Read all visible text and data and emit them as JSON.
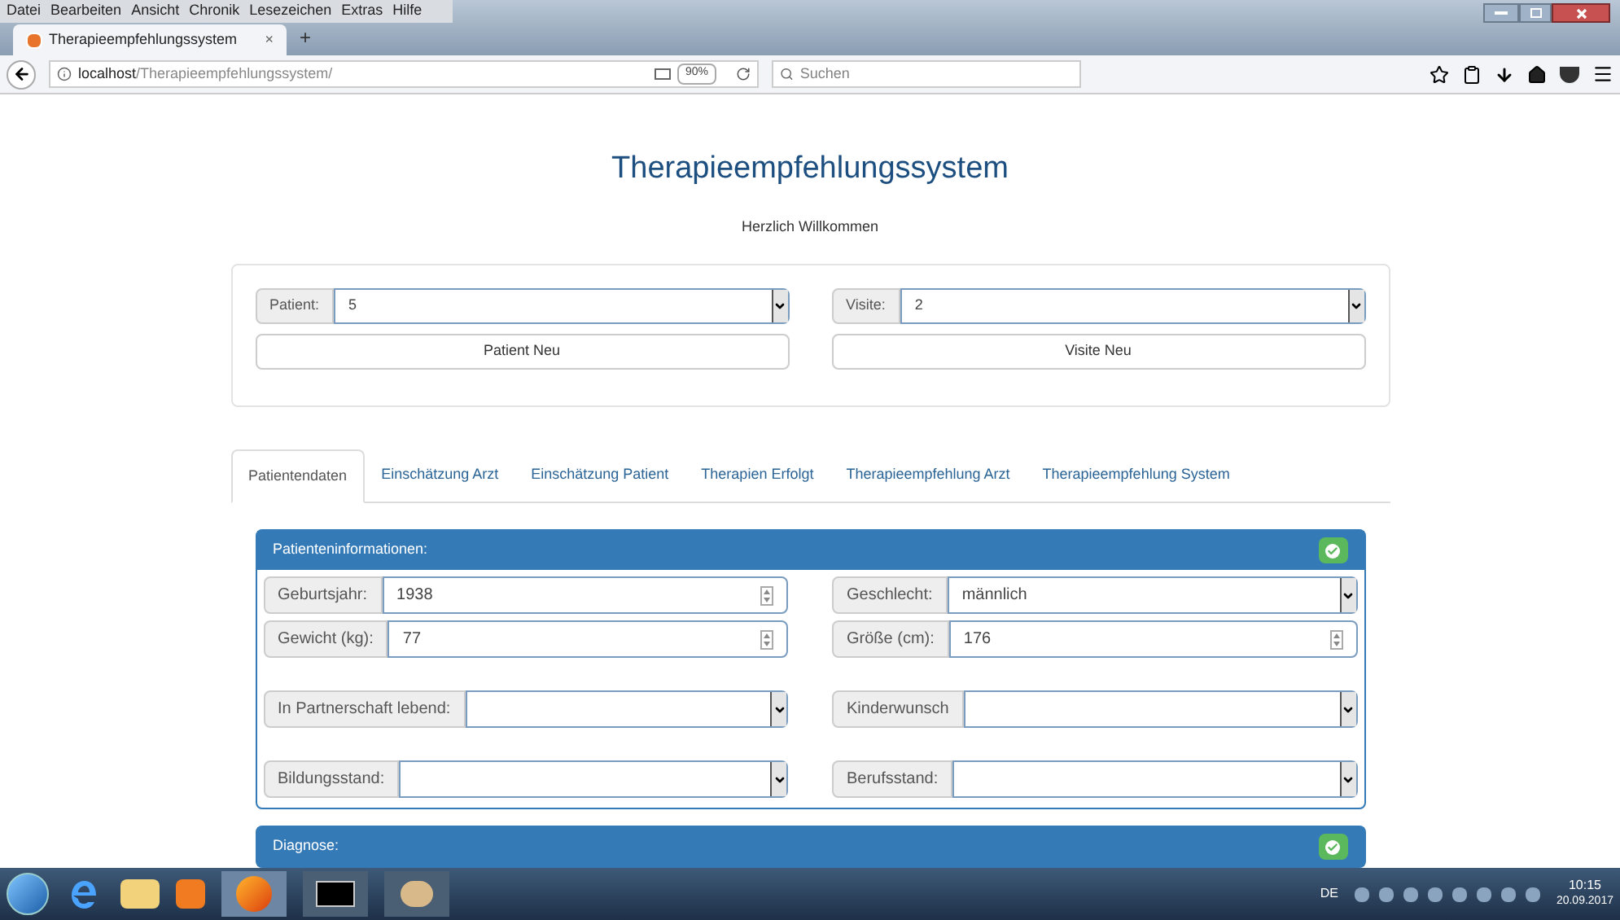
{
  "menu_bar": [
    "Datei",
    "Bearbeiten",
    "Ansicht",
    "Chronik",
    "Lesezeichen",
    "Extras",
    "Hilfe"
  ],
  "browser_tab": {
    "title": "Therapieempfehlungssystem",
    "close": "×",
    "new_tab": "+"
  },
  "address_bar": {
    "host": "localhost",
    "path": "/Therapieempfehlungssystem/",
    "zoom": "90%",
    "search_placeholder": "Suchen"
  },
  "page": {
    "title": "Therapieempfehlungssystem",
    "subtitle": "Herzlich Willkommen",
    "selectors": [
      {
        "label": "Patient:",
        "value": "5",
        "button": "Patient Neu"
      },
      {
        "label": "Visite:",
        "value": "2",
        "button": "Visite Neu"
      }
    ],
    "tabs": [
      {
        "label": "Patientendaten",
        "selected": true
      },
      {
        "label": "Einschätzung Arzt",
        "selected": false
      },
      {
        "label": "Einschätzung Patient",
        "selected": false
      },
      {
        "label": "Therapien Erfolgt",
        "selected": false
      },
      {
        "label": "Therapieempfehlung Arzt",
        "selected": false
      },
      {
        "label": "Therapieempfehlung System",
        "selected": false
      }
    ],
    "panels": [
      {
        "title": "Patienteninformationen:",
        "rows": [
          [
            {
              "label": "Geburtsjahr:",
              "kind": "number",
              "value": "1938"
            },
            {
              "label": "Geschlecht:",
              "kind": "select",
              "value": "männlich"
            }
          ],
          [
            {
              "label": "Gewicht (kg):",
              "kind": "number",
              "value": "77"
            },
            {
              "label": "Größe (cm):",
              "kind": "number",
              "value": "176"
            }
          ],
          [
            {
              "label": "In Partnerschaft lebend:",
              "kind": "select"
            },
            {
              "label": "Kinderwunsch",
              "kind": "select"
            }
          ],
          [
            {
              "label": "Bildungsstand:",
              "kind": "select"
            },
            {
              "label": "Berufsstand:",
              "kind": "select"
            }
          ]
        ]
      },
      {
        "title": "Diagnose:"
      }
    ]
  },
  "taskbar": {
    "language": "DE",
    "time": "10:15",
    "date": "20.09.2017"
  }
}
